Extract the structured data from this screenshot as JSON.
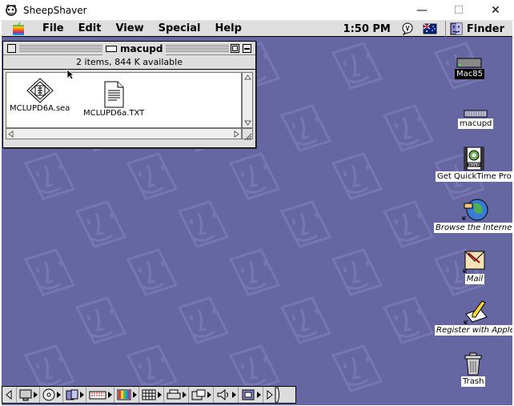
{
  "host_window": {
    "title": "SheepShaver",
    "icon": "sheep-icon",
    "controls": {
      "minimize": "—",
      "maximize": "☐",
      "close": "✕"
    }
  },
  "menubar": {
    "apple_icon": "apple-rainbow-icon",
    "items": [
      "File",
      "Edit",
      "View",
      "Special",
      "Help"
    ],
    "clock": "1:50 PM",
    "status_icons": [
      "help-balloon-icon",
      "australia-flag-icon"
    ],
    "active_app_icon": "finder-icon",
    "active_app": "Finder"
  },
  "finder_window": {
    "title": "macupd",
    "info": "2 items, 844 K available",
    "files": [
      {
        "name": "MCLUPD6A.sea",
        "icon": "self-extracting-archive-icon"
      },
      {
        "name": "MCLUPD6a.TXT",
        "icon": "text-document-icon"
      }
    ]
  },
  "desktop_icons": [
    {
      "name": "Mac85",
      "icon": "hard-disk-icon",
      "selected": true
    },
    {
      "name": "macupd",
      "icon": "disk-image-icon",
      "selected": false
    },
    {
      "name": "Get QuickTime Pro",
      "icon": "quicktime-movie-icon",
      "selected": false
    },
    {
      "name": "Browse the Internet",
      "icon": "internet-globe-alias-icon",
      "selected": false,
      "italic": true
    },
    {
      "name": "Mail",
      "icon": "mail-alias-icon",
      "selected": false,
      "italic": true
    },
    {
      "name": "Register with Apple",
      "icon": "register-alias-icon",
      "selected": false,
      "italic": true
    },
    {
      "name": "Trash",
      "icon": "trash-icon",
      "selected": false
    }
  ],
  "control_strip": {
    "modules": [
      "strip-scroll-left-icon",
      "monitor-icon",
      "cd-icon",
      "file-sharing-icon",
      "keychain-icon",
      "color-depth-icon",
      "resolution-icon",
      "printer-icon",
      "location-icon",
      "sound-volume-icon",
      "remote-access-icon",
      "strip-scroll-right-icon"
    ]
  }
}
